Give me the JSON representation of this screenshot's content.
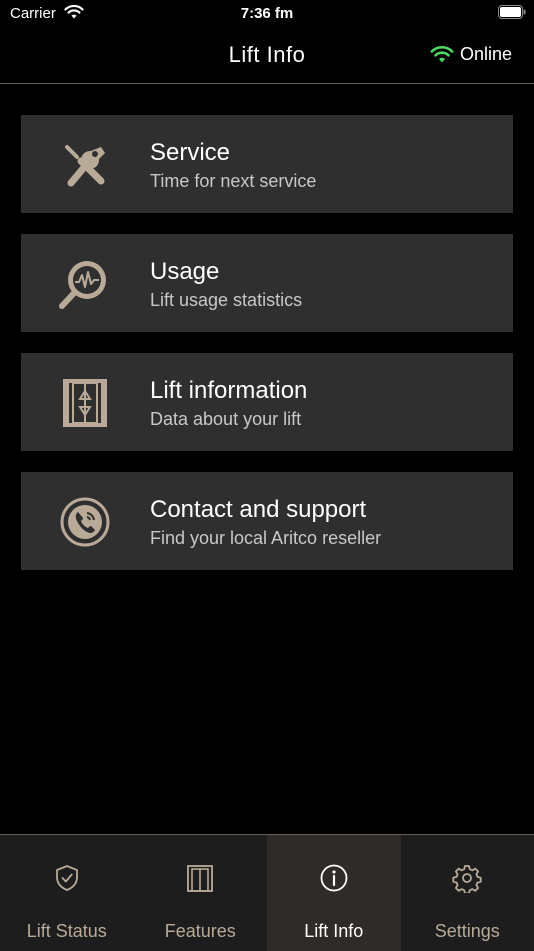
{
  "status_bar": {
    "carrier": "Carrier",
    "time": "7:36 fm"
  },
  "header": {
    "title": "Lift Info",
    "connection_status": "Online",
    "connection_color": "#4cd964"
  },
  "menu": {
    "items": [
      {
        "title": "Service",
        "subtitle": "Time for next service",
        "icon": "wrench-screwdriver-icon"
      },
      {
        "title": "Usage",
        "subtitle": "Lift usage statistics",
        "icon": "statistics-magnifier-icon"
      },
      {
        "title": "Lift information",
        "subtitle": "Data about your lift",
        "icon": "lift-doors-icon"
      },
      {
        "title": "Contact and support",
        "subtitle": "Find your local Aritco reseller",
        "icon": "phone-icon"
      }
    ]
  },
  "tabbar": {
    "tabs": [
      {
        "label": "Lift Status",
        "icon": "shield-check-icon",
        "active": false
      },
      {
        "label": "Features",
        "icon": "lift-panel-icon",
        "active": false
      },
      {
        "label": "Lift Info",
        "icon": "info-icon",
        "active": true
      },
      {
        "label": "Settings",
        "icon": "gear-icon",
        "active": false
      }
    ]
  },
  "colors": {
    "accent": "#b9aa98",
    "card_bg": "#2f2f2f",
    "divider": "#6b5f53"
  }
}
